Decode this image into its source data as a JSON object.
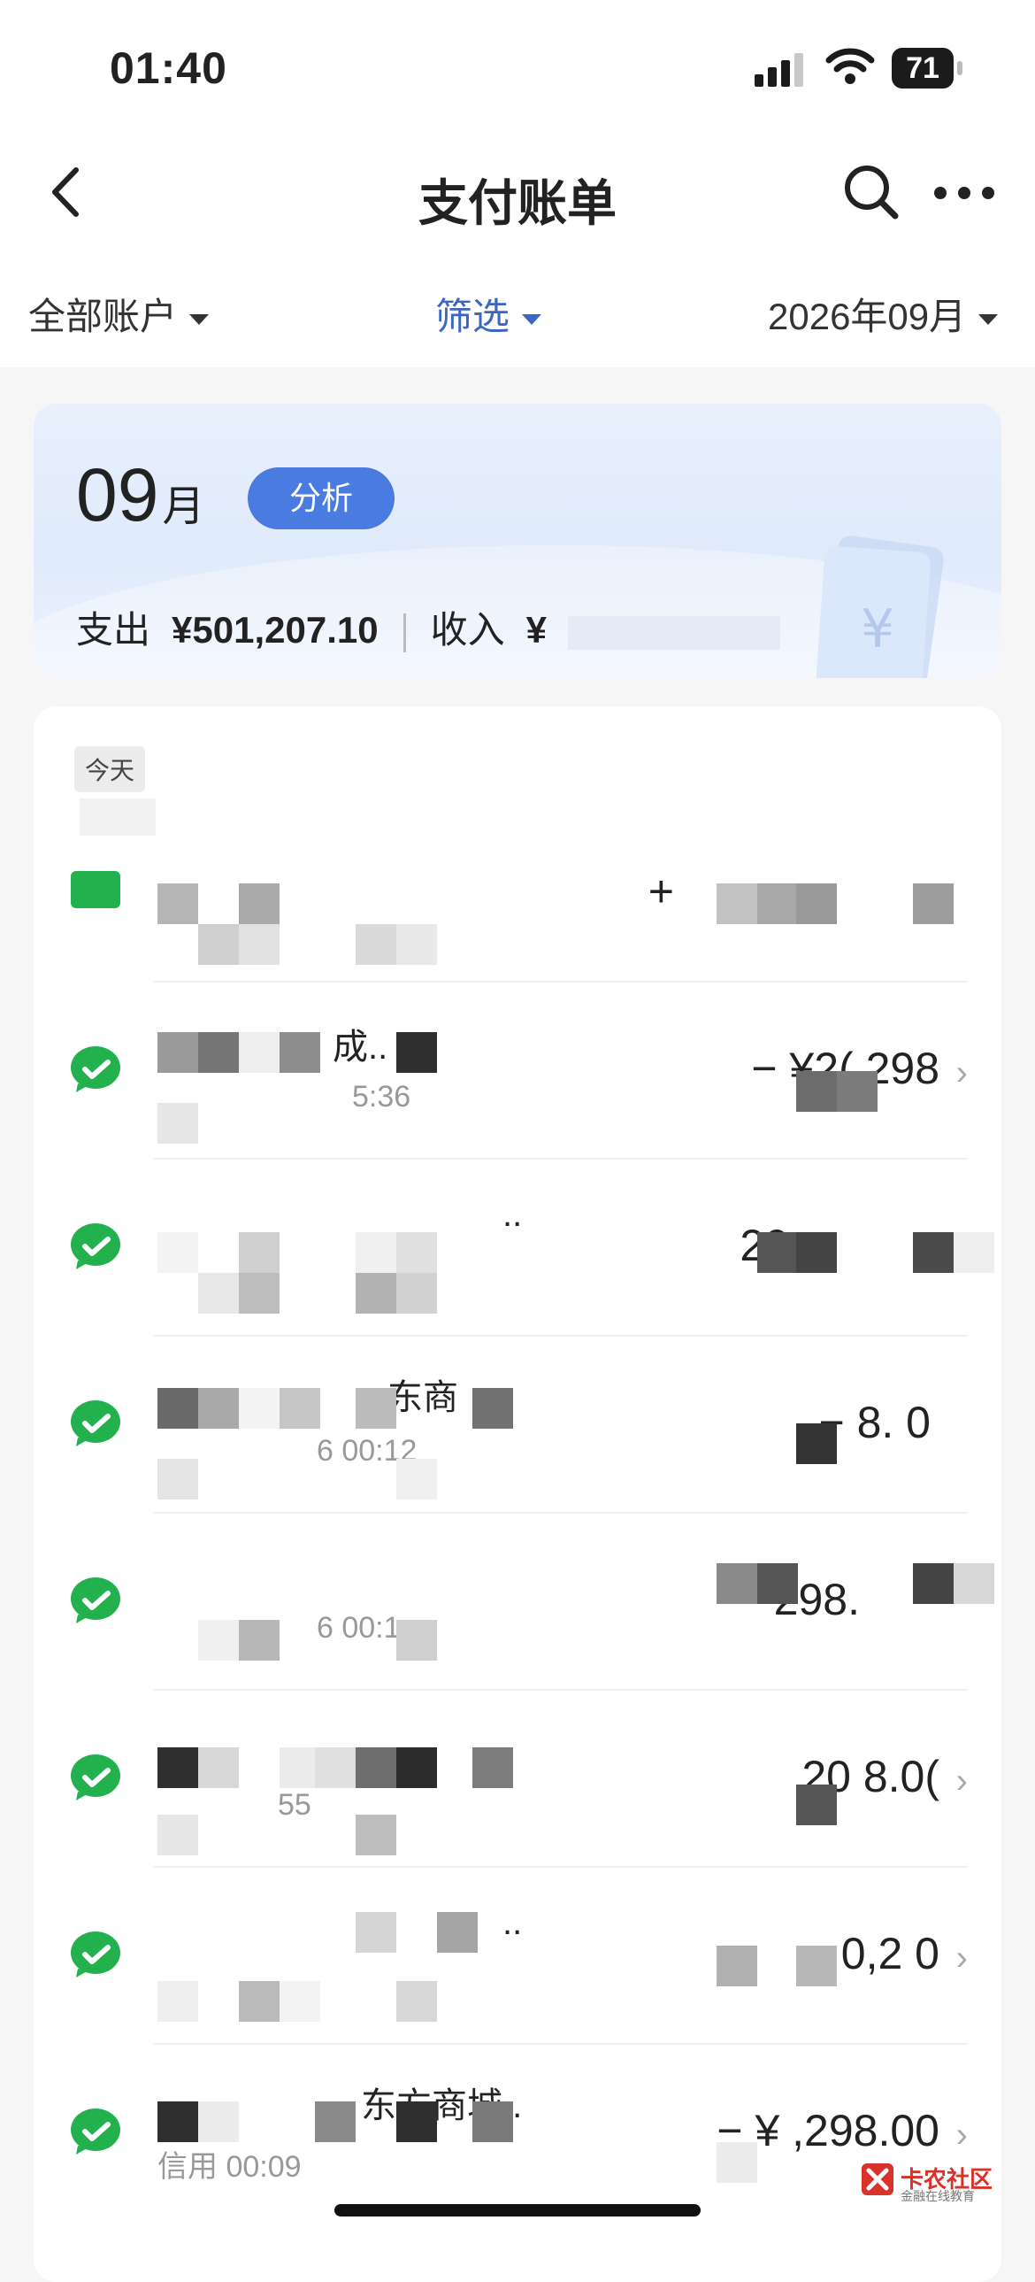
{
  "status_bar": {
    "time": "01:40",
    "battery": "71"
  },
  "nav": {
    "title": "支付账单"
  },
  "filters": {
    "account": "全部账户",
    "filter": "筛选",
    "month": "2026年09月"
  },
  "summary": {
    "month_num": "09",
    "month_unit": "月",
    "analyze_label": "分析",
    "expense_label": "支出",
    "expense_value": "¥501,207.10",
    "income_label": "收入",
    "income_value": "¥"
  },
  "list": {
    "section_label": "今天",
    "rows": [
      {
        "name": "",
        "sub": "",
        "amount": "+"
      },
      {
        "name": "成..",
        "sub": "5:36",
        "amount": "− ¥2( 298"
      },
      {
        "name": "..",
        "sub": "",
        "amount": "20"
      },
      {
        "name": "东商",
        "sub": "6 00:12",
        "amount": "− 8. 0"
      },
      {
        "name": "",
        "sub": "6 00:1",
        "amount": "298."
      },
      {
        "name": "",
        "sub": "55",
        "amount": "20 8.0("
      },
      {
        "name": "..",
        "sub": "",
        "amount": "0,2 0"
      },
      {
        "name": "东方商城..",
        "sub": "信用 00:09",
        "amount": "− ¥ ,298.00"
      }
    ]
  },
  "watermark": {
    "name": "卡农社区",
    "tagline": "金融在线教育"
  },
  "colors": {
    "accent_blue": "#3b66c4",
    "wechat_green": "#22b14c",
    "analyze_button": "#4a7be0"
  }
}
